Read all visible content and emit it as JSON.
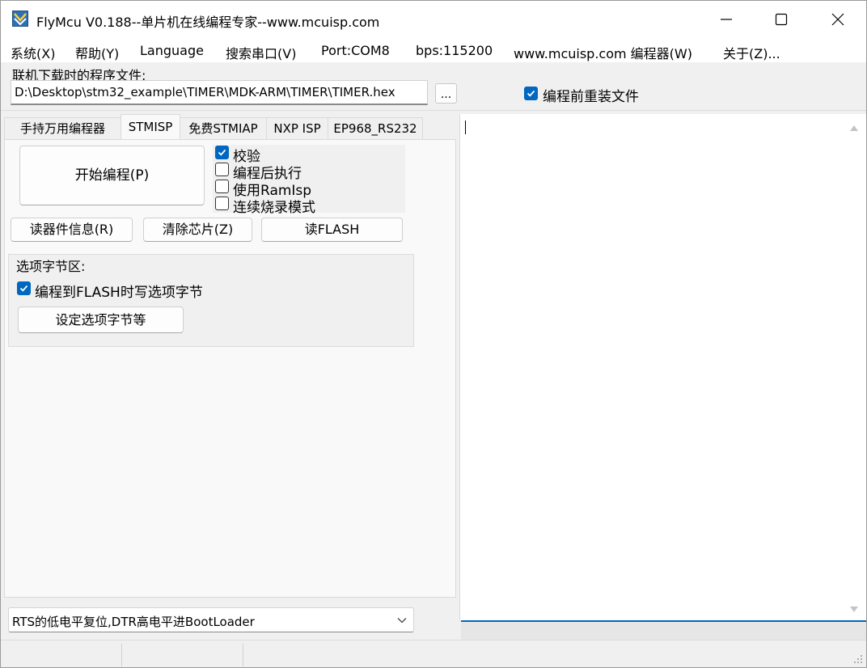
{
  "window": {
    "title": "FlyMcu V0.188--单片机在线编程专家--www.mcuisp.com"
  },
  "menu": {
    "items": [
      "系统(X)",
      "帮助(Y)",
      "Language",
      "搜索串口(V)",
      "Port:COM8",
      "bps:115200",
      "www.mcuisp.com 编程器(W)",
      "关于(Z)..."
    ]
  },
  "file": {
    "label": "联机下载时的程序文件:",
    "path": "D:\\Desktop\\stm32_example\\TIMER\\MDK-ARM\\TIMER\\TIMER.hex",
    "browse_label": "...",
    "reload_label": "编程前重装文件",
    "reload_checked": true
  },
  "tabs": [
    "手持万用编程器",
    "STMISP",
    "免费STMIAP",
    "NXP ISP",
    "EP968_RS232"
  ],
  "active_tab": "STMISP",
  "stmisp": {
    "start_button": "开始编程(P)",
    "options": [
      {
        "label": "校验",
        "checked": true
      },
      {
        "label": "编程后执行",
        "checked": false
      },
      {
        "label": "使用RamIsp",
        "checked": false
      },
      {
        "label": "连续烧录模式",
        "checked": false
      }
    ],
    "read_info_button": "读器件信息(R)",
    "erase_button": "清除芯片(Z)",
    "read_flash_button": "读FLASH",
    "option_bytes": {
      "title": "选项字节区:",
      "write_label": "编程到FLASH时写选项字节",
      "write_checked": true,
      "settings_button": "设定选项字节等"
    },
    "boot_mode": "RTS的低电平复位,DTR高电平进BootLoader"
  },
  "icons": {
    "app": "flymcu-logo-icon",
    "minimize": "minimize-icon",
    "maximize": "maximize-icon",
    "close": "close-icon",
    "dropdown": "chevron-down-icon",
    "check": "checkmark-icon"
  },
  "colors": {
    "accent": "#0067c0"
  }
}
